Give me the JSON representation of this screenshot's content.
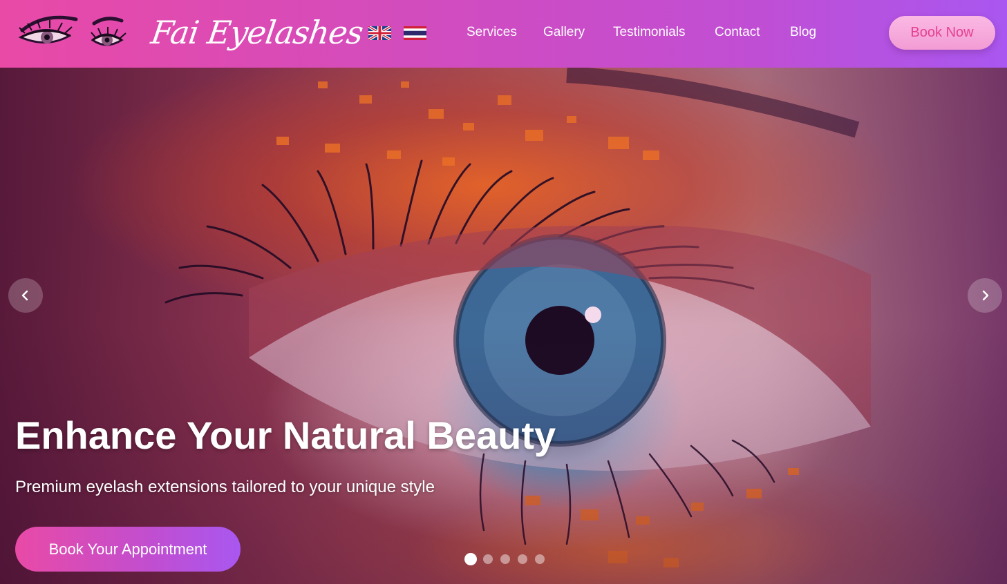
{
  "brand": {
    "name": "Fai Eyelashes",
    "logo_icon": "eyelash-eyes-icon"
  },
  "languages": [
    {
      "code": "EN",
      "icon": "uk-flag-icon"
    },
    {
      "code": "TH",
      "icon": "thai-flag-icon"
    }
  ],
  "nav": [
    {
      "label": "Services"
    },
    {
      "label": "Gallery"
    },
    {
      "label": "Testimonials"
    },
    {
      "label": "Contact"
    },
    {
      "label": "Blog"
    }
  ],
  "header_button": {
    "label": "Book Now"
  },
  "hero": {
    "title": "Enhance Your Natural Beauty",
    "subtitle": "Premium eyelash extensions tailored to your unique style",
    "cta_label": "Book Your Appointment",
    "prev_icon": "chevron-left-icon",
    "next_icon": "chevron-right-icon",
    "slide_count": 5,
    "active_slide": 1
  },
  "colors": {
    "header_start": "#e94aa6",
    "header_end": "#a957f0",
    "book_now_bg": "#fbb9e4",
    "book_now_text": "#e5408f"
  }
}
